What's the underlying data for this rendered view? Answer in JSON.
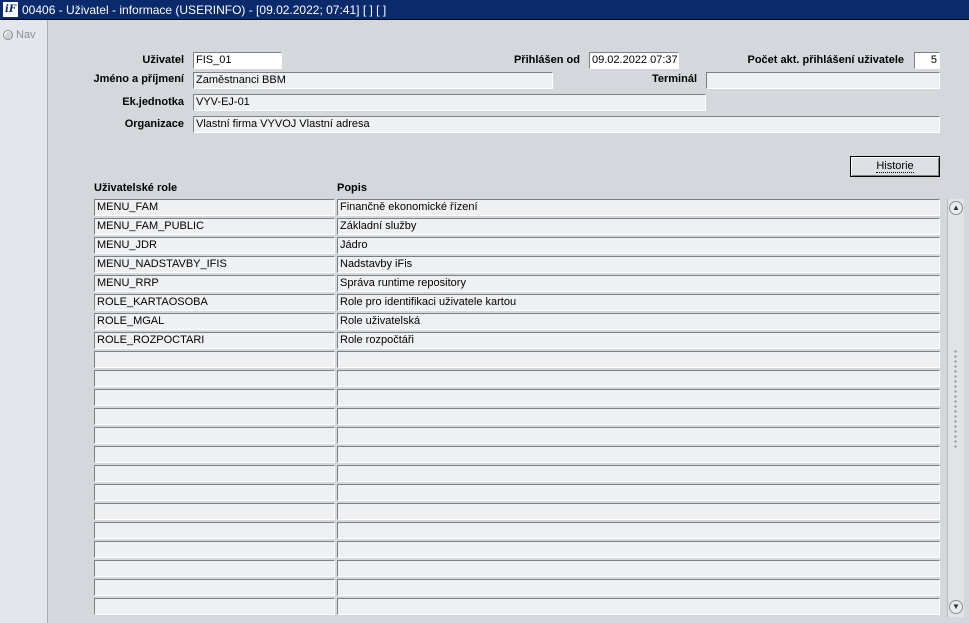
{
  "window": {
    "logo": "iF",
    "title": "00406 - Uživatel - informace (USERINFO) - [09.02.2022; 07:41]  [ ]  [ ]"
  },
  "nav": {
    "label": "Nav"
  },
  "form": {
    "user_label": "Uživatel",
    "user_value": "FIS_01",
    "login_since_label": "Přihlášen od",
    "login_since_value": "09.02.2022 07:37",
    "active_logins_label": "Počet akt. přihlášení uživatele",
    "active_logins_value": "5",
    "name_label": "Jméno a příjmení",
    "name_value": "Zaměstnanci BBM",
    "terminal_label": "Terminál",
    "terminal_value": "",
    "unit_label": "Ek.jednotka",
    "unit_value": "VYV-EJ-01",
    "org_label": "Organizace",
    "org_value": "Vlastní firma VYVOJ Vlastní adresa"
  },
  "history_button": "Historie",
  "table": {
    "headers": [
      "Uživatelské role",
      "Popis"
    ],
    "rows": [
      [
        "MENU_FAM",
        "Finančně ekonomické řízení"
      ],
      [
        "MENU_FAM_PUBLIC",
        "Základní služby"
      ],
      [
        "MENU_JDR",
        "Jádro"
      ],
      [
        "MENU_NADSTAVBY_IFIS",
        "Nadstavby iFis"
      ],
      [
        "MENU_RRP",
        "Správa runtime repository"
      ],
      [
        "ROLE_KARTAOSOBA",
        "Role pro identifikaci uživatele kartou"
      ],
      [
        "ROLE_MGAL",
        "Role uživatelská"
      ],
      [
        "ROLE_ROZPOCTARI",
        "Role rozpočtáři"
      ],
      [
        "",
        ""
      ],
      [
        "",
        ""
      ],
      [
        "",
        ""
      ],
      [
        "",
        ""
      ],
      [
        "",
        ""
      ],
      [
        "",
        ""
      ],
      [
        "",
        ""
      ],
      [
        "",
        ""
      ],
      [
        "",
        ""
      ],
      [
        "",
        ""
      ],
      [
        "",
        ""
      ],
      [
        "",
        ""
      ],
      [
        "",
        ""
      ],
      [
        "",
        ""
      ]
    ]
  },
  "icons": {
    "logo": "ifis-logo-icon",
    "scroll_up": "arrow-up-icon",
    "scroll_down": "arrow-down-icon"
  }
}
